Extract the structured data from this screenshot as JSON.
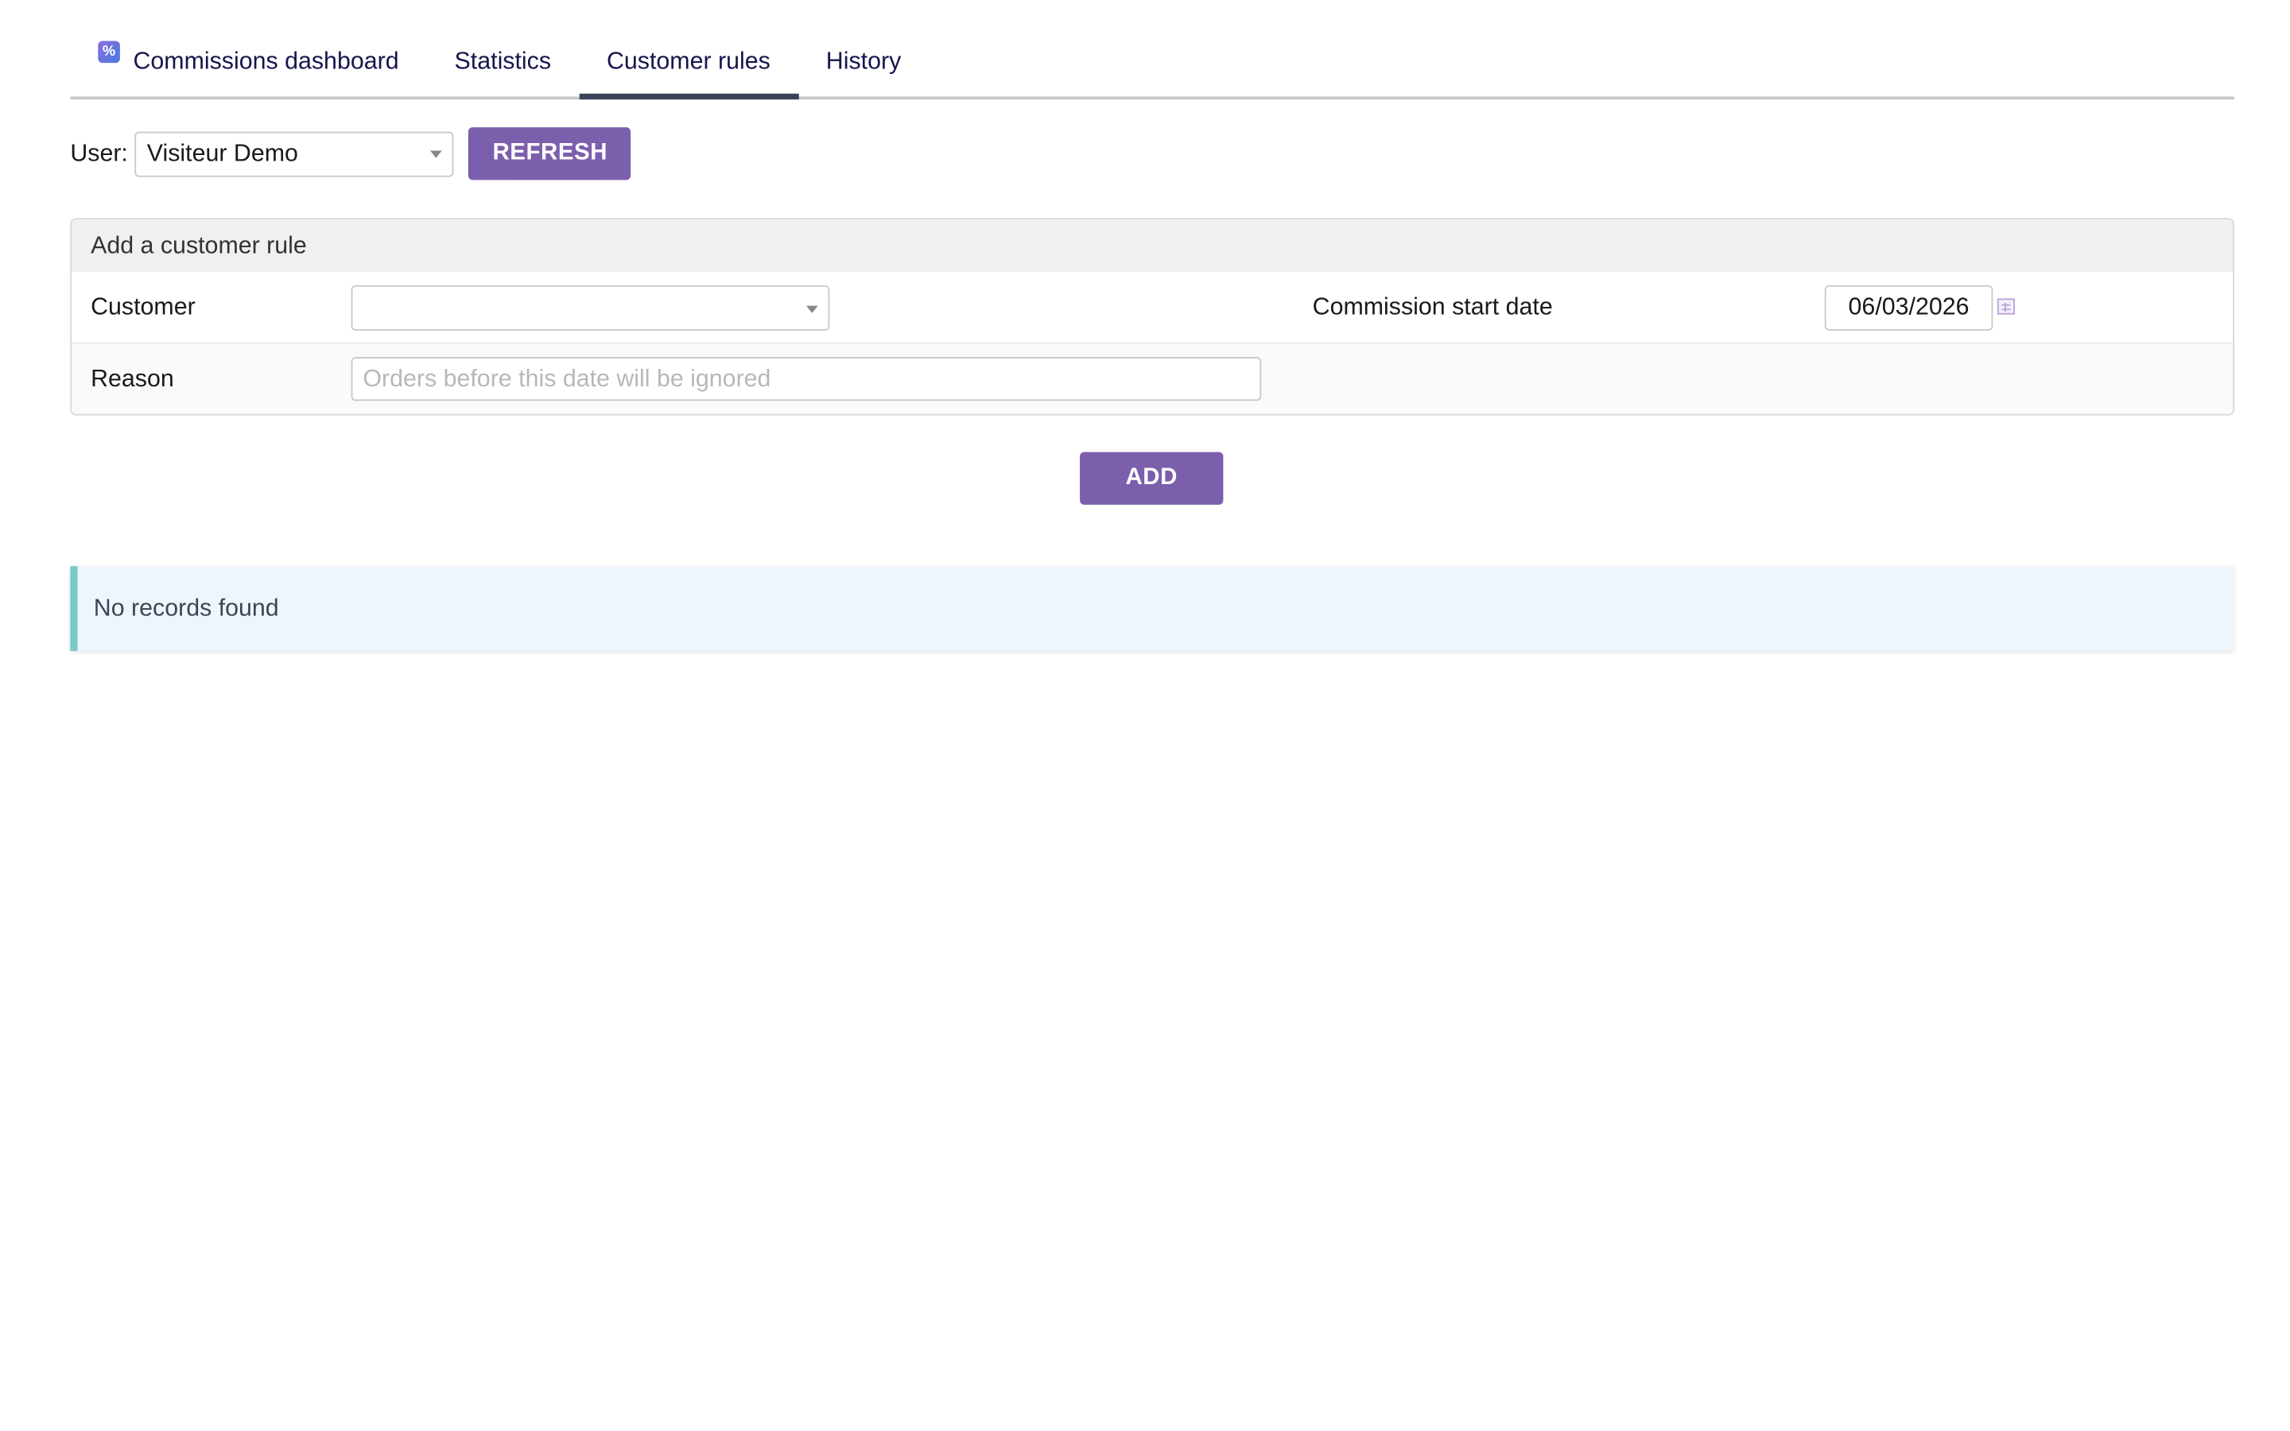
{
  "tabs": [
    {
      "label": "Commissions dashboard",
      "icon": "percent-icon",
      "active": false
    },
    {
      "label": "Statistics",
      "active": false
    },
    {
      "label": "Customer rules",
      "active": true
    },
    {
      "label": "History",
      "active": false
    }
  ],
  "user_filter": {
    "label": "User:",
    "selected": "Visiteur Demo",
    "refresh_label": "REFRESH"
  },
  "add_rule_panel": {
    "title": "Add a customer rule",
    "customer_label": "Customer",
    "customer_value": "",
    "start_date_label": "Commission start date",
    "start_date_value": "06/03/2026",
    "reason_label": "Reason",
    "reason_placeholder": "Orders before this date will be ignored"
  },
  "add_button": {
    "label": "ADD"
  },
  "results": {
    "empty_message": "No records found"
  },
  "colors": {
    "accent": "#7b5fac",
    "tab_text": "#16164e",
    "active_tab_underline": "#3a4257",
    "notice_bg": "#eef6fc",
    "notice_border": "#7ac9c6"
  }
}
